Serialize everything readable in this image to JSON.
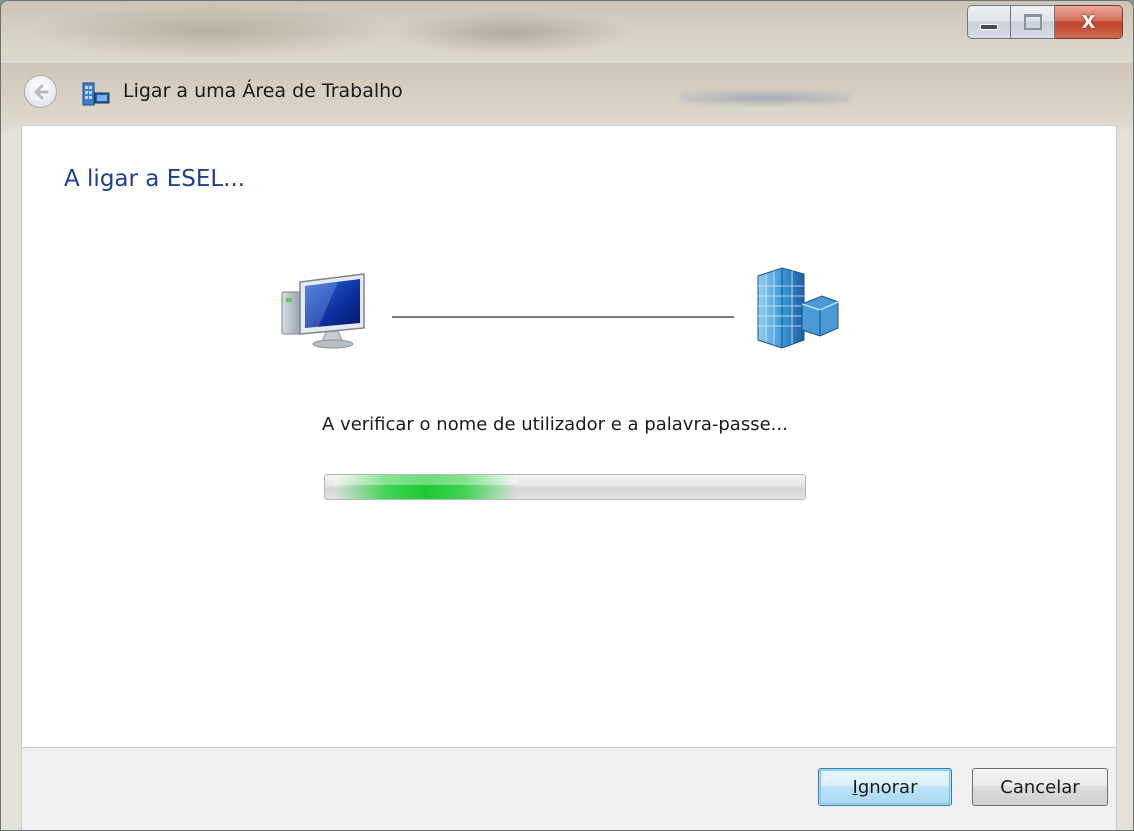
{
  "window": {
    "caption_buttons": {
      "minimize_icon": "minimize-icon",
      "maximize_icon": "maximize-icon",
      "close_glyph": "X"
    }
  },
  "navbar": {
    "title": "Ligar a uma Área de Trabalho",
    "back_icon": "back-arrow-icon",
    "app_icon": "remote-desktop-icon"
  },
  "main": {
    "heading": "A ligar a ESEL...",
    "local_icon": "computer-icon",
    "remote_icon": "server-building-icon",
    "status_text": "A verificar o nome de utilizador e a palavra-passe...",
    "progress": {
      "indeterminate": true,
      "glow_start_fraction": 0.02,
      "glow_end_fraction": 0.4
    }
  },
  "footer": {
    "ignore_button": {
      "accel": "I",
      "rest": "gnorar"
    },
    "cancel_button": "Cancelar"
  },
  "colors": {
    "heading": "#1e3f8f",
    "progress_green": "#1ec832",
    "default_button_border": "#3c7fb1",
    "close_button": "#c2432a"
  }
}
